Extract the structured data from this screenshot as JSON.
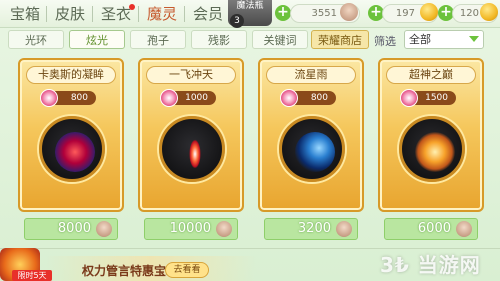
{
  "top_tabs": [
    {
      "label": "宝箱",
      "active": false
    },
    {
      "label": "皮肤",
      "active": false
    },
    {
      "label": "圣衣",
      "active": false,
      "dot": true
    },
    {
      "label": "魔灵",
      "active": true
    },
    {
      "label": "会员",
      "active": false
    }
  ],
  "magic_badge": {
    "label": "魔法瓶",
    "count": "3"
  },
  "currencies": [
    {
      "value": "3551",
      "icon": "face-icon"
    },
    {
      "value": "197",
      "icon": "coin-icon"
    },
    {
      "value": "120",
      "icon": "coin-icon"
    }
  ],
  "sub_tabs": [
    {
      "label": "光环",
      "active": false
    },
    {
      "label": "炫光",
      "active": true
    },
    {
      "label": "孢子",
      "active": false
    },
    {
      "label": "残影",
      "active": false
    },
    {
      "label": "关键词",
      "active": false
    },
    {
      "label": "荣耀商店",
      "active": false,
      "highlight": true
    }
  ],
  "filter": {
    "label": "筛选",
    "value": "全部"
  },
  "items": [
    {
      "name": "卡奥斯的凝眸",
      "cost": "800",
      "price": "8000"
    },
    {
      "name": "一飞冲天",
      "cost": "1000",
      "price": "10000"
    },
    {
      "name": "流星雨",
      "cost": "800",
      "price": "3200"
    },
    {
      "name": "超神之巅",
      "cost": "1500",
      "price": "6000"
    }
  ],
  "promo": {
    "tag": "限时5天",
    "text": "权力管言特惠宝箱",
    "button": "去看看"
  },
  "watermark": "3₺ 当游网"
}
